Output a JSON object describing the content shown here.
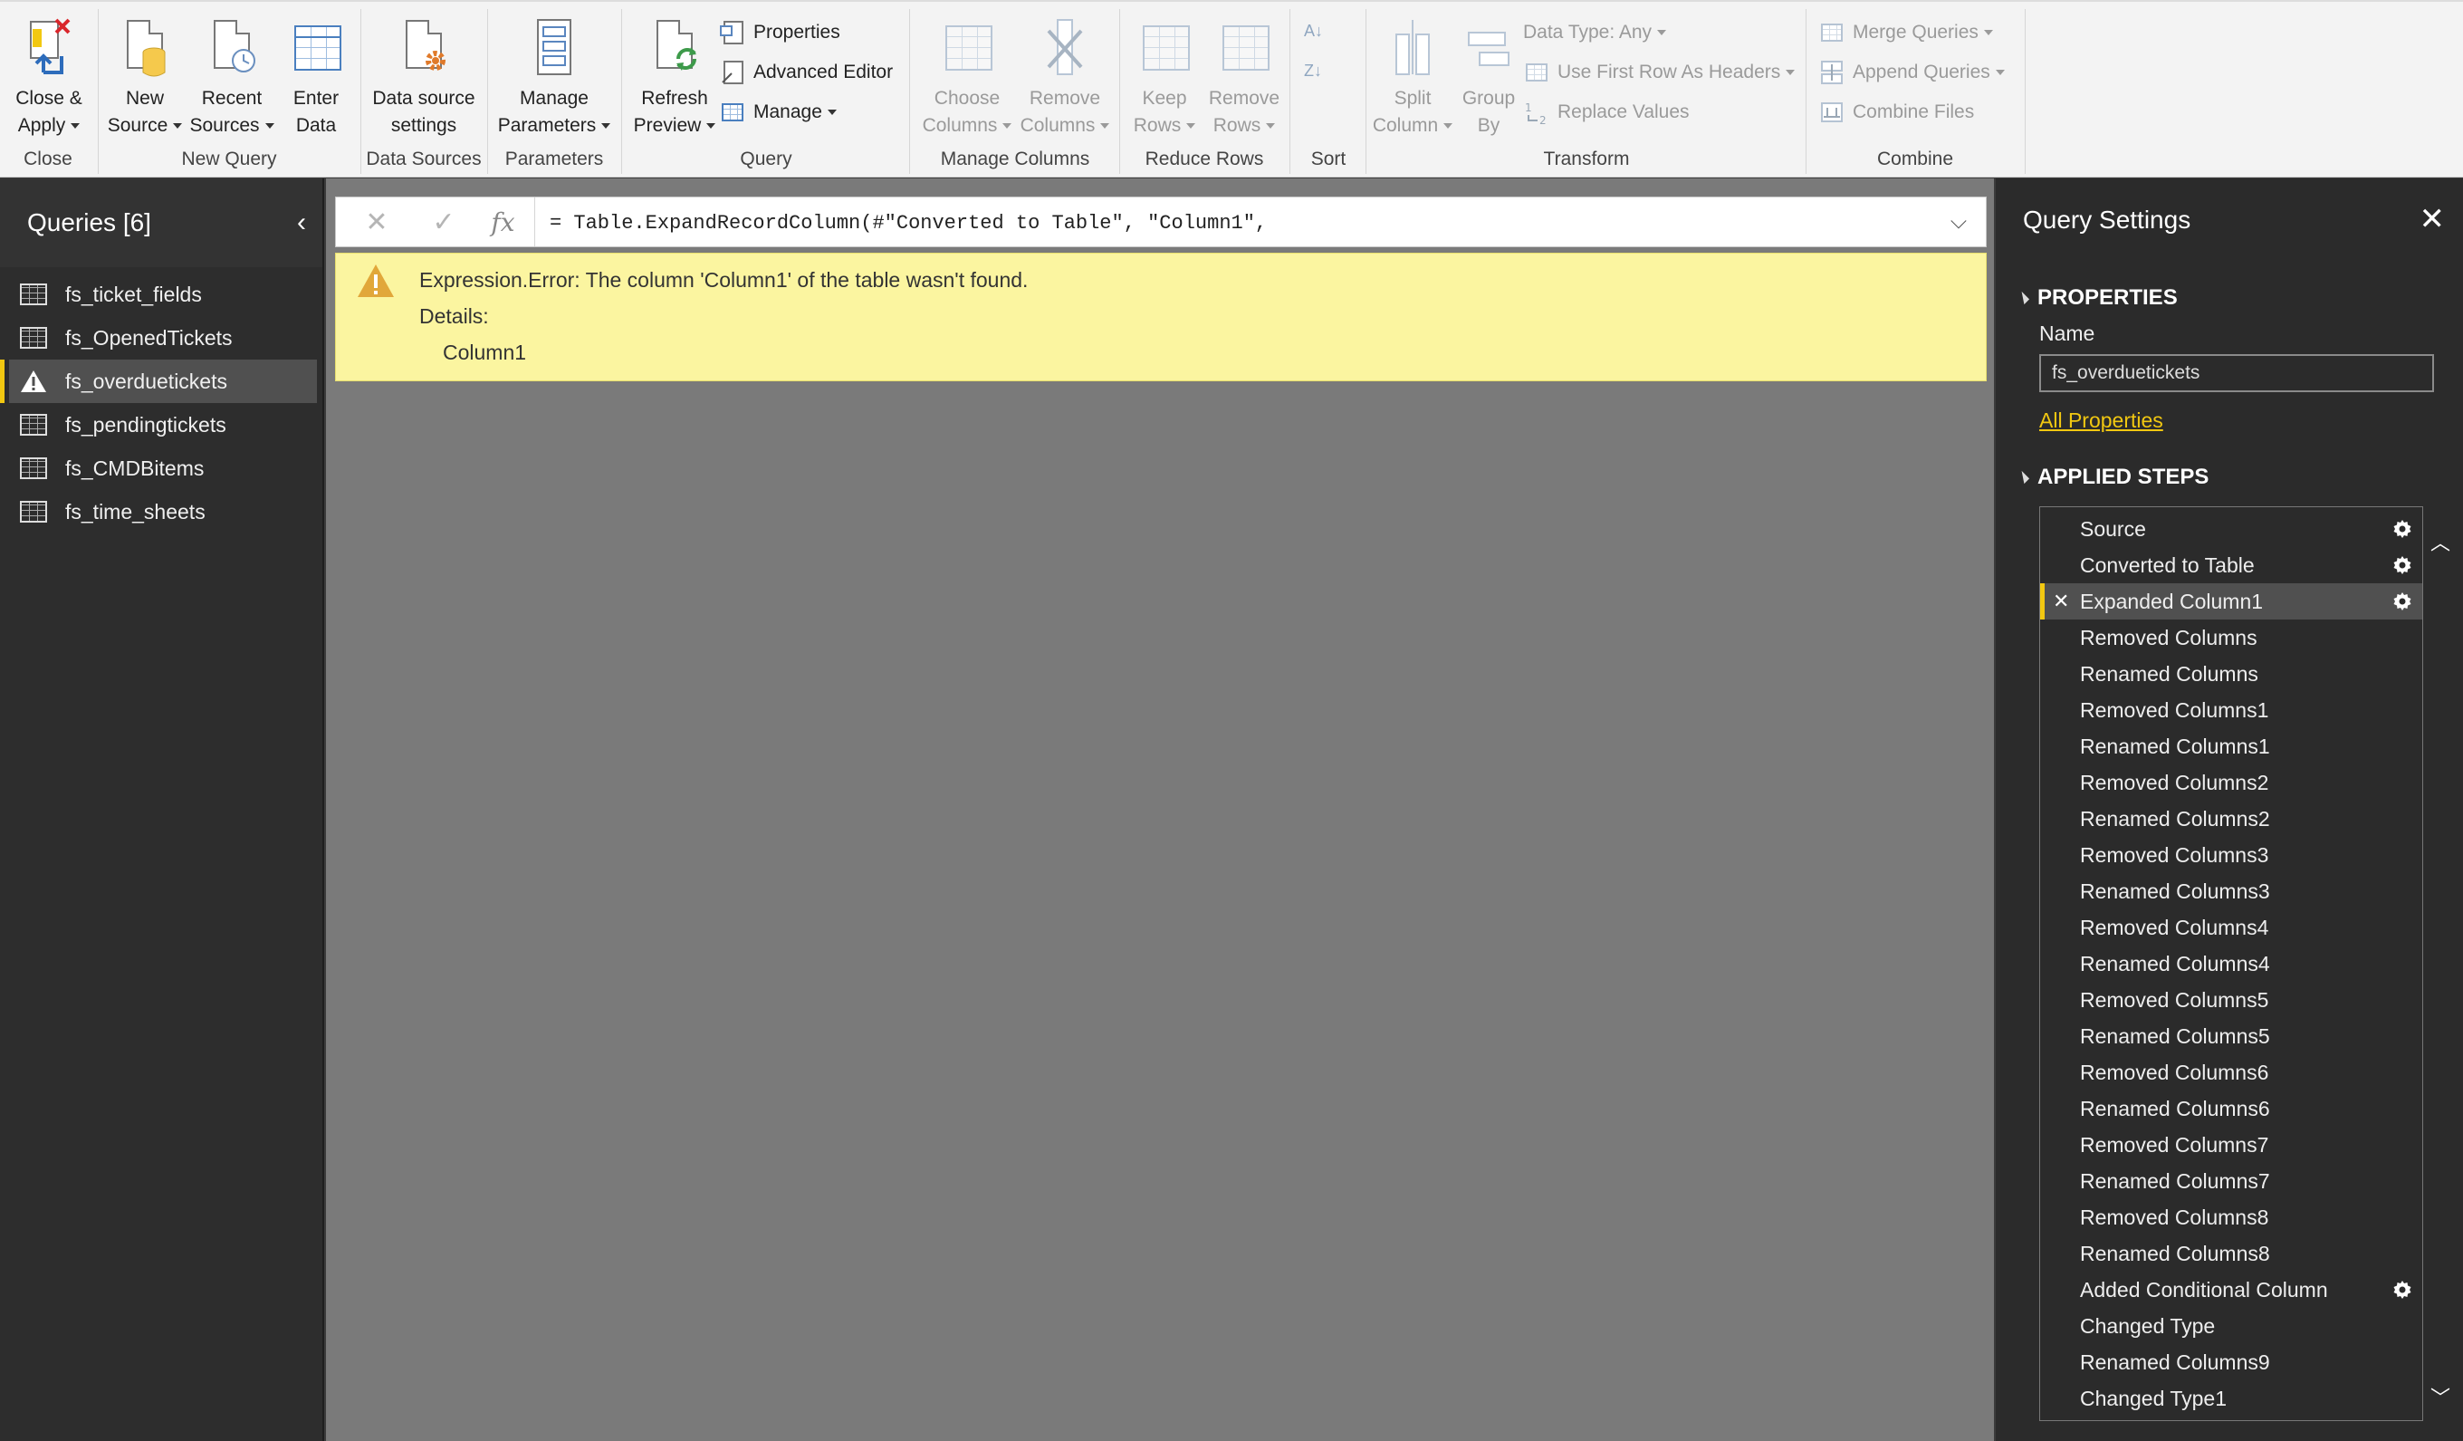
{
  "ribbon": {
    "close": {
      "title": "Close",
      "close_apply": [
        "Close &",
        "Apply"
      ]
    },
    "new_query": {
      "title": "New Query",
      "new_source": [
        "New",
        "Source"
      ],
      "recent_sources": [
        "Recent",
        "Sources"
      ],
      "enter_data": [
        "Enter",
        "Data"
      ]
    },
    "data_sources": {
      "title": "Data Sources",
      "settings": [
        "Data source",
        "settings"
      ]
    },
    "parameters": {
      "title": "Parameters",
      "manage": [
        "Manage",
        "Parameters"
      ]
    },
    "query": {
      "title": "Query",
      "refresh": [
        "Refresh",
        "Preview"
      ],
      "properties": "Properties",
      "advanced_editor": "Advanced Editor",
      "manage": "Manage"
    },
    "manage_columns": {
      "title": "Manage Columns",
      "choose": [
        "Choose",
        "Columns"
      ],
      "remove": [
        "Remove",
        "Columns"
      ]
    },
    "reduce_rows": {
      "title": "Reduce Rows",
      "keep": [
        "Keep",
        "Rows"
      ],
      "remove": [
        "Remove",
        "Rows"
      ]
    },
    "sort": {
      "title": "Sort"
    },
    "transform": {
      "title": "Transform",
      "split": [
        "Split",
        "Column"
      ],
      "group": [
        "Group",
        "By"
      ],
      "data_type": "Data Type: Any",
      "first_row": "Use First Row As Headers",
      "replace": "Replace Values"
    },
    "combine": {
      "title": "Combine",
      "merge": "Merge Queries",
      "append": "Append Queries",
      "combine_files": "Combine Files"
    }
  },
  "queries": {
    "title": "Queries [6]",
    "items": [
      {
        "name": "fs_ticket_fields",
        "icon": "table-icon"
      },
      {
        "name": "fs_OpenedTickets",
        "icon": "table-icon"
      },
      {
        "name": "fs_overduetickets",
        "icon": "warning-icon",
        "selected": true
      },
      {
        "name": "fs_pendingtickets",
        "icon": "table-icon"
      },
      {
        "name": "fs_CMDBitems",
        "icon": "table-icon"
      },
      {
        "name": "fs_time_sheets",
        "icon": "table-icon"
      }
    ]
  },
  "formula": {
    "fx": "fx",
    "value": "= Table.ExpandRecordColumn(#\"Converted to Table\", \"Column1\","
  },
  "error": {
    "message": "Expression.Error: The column 'Column1' of the table wasn't found.",
    "details_label": "Details:",
    "details_value": "Column1"
  },
  "settings": {
    "title": "Query Settings",
    "properties_header": "PROPERTIES",
    "name_label": "Name",
    "name_value": "fs_overduetickets",
    "all_properties": "All Properties",
    "steps_header": "APPLIED STEPS",
    "steps": [
      {
        "label": "Source",
        "gear": true
      },
      {
        "label": "Converted to Table",
        "gear": true
      },
      {
        "label": "Expanded Column1",
        "gear": true,
        "selected": true,
        "error": true
      },
      {
        "label": "Removed Columns"
      },
      {
        "label": "Renamed Columns"
      },
      {
        "label": "Removed Columns1"
      },
      {
        "label": "Renamed Columns1"
      },
      {
        "label": "Removed Columns2"
      },
      {
        "label": "Renamed Columns2"
      },
      {
        "label": "Removed Columns3"
      },
      {
        "label": "Renamed Columns3"
      },
      {
        "label": "Removed Columns4"
      },
      {
        "label": "Renamed Columns4"
      },
      {
        "label": "Removed Columns5"
      },
      {
        "label": "Renamed Columns5"
      },
      {
        "label": "Removed Columns6"
      },
      {
        "label": "Renamed Columns6"
      },
      {
        "label": "Removed Columns7"
      },
      {
        "label": "Renamed Columns7"
      },
      {
        "label": "Removed Columns8"
      },
      {
        "label": "Renamed Columns8"
      },
      {
        "label": "Added Conditional Column",
        "gear": true
      },
      {
        "label": "Changed Type"
      },
      {
        "label": "Renamed Columns9"
      },
      {
        "label": "Changed Type1"
      }
    ]
  },
  "colors": {
    "accent": "#f2c811",
    "error_bg": "#fbf5a0",
    "ribbon_bg": "#f3f3f3",
    "pane_bg": "#2d2d2d",
    "main_bg": "#7a7a7a"
  }
}
